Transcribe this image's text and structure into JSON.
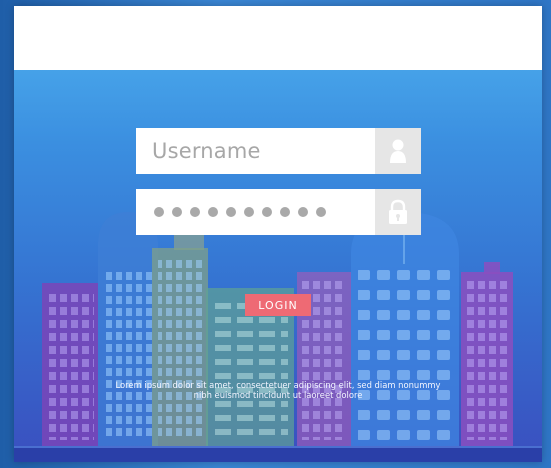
{
  "login_form": {
    "username_placeholder": "Username",
    "password_mask_count": 10,
    "login_label": "LOGIN",
    "tagline": "Lorem ipsum dolor sit amet, consectetuer adipiscing elit, sed diam nonummy nibh euismod tincidunt ut laoreet dolore"
  },
  "icons": {
    "username": "user-icon",
    "password": "lock-icon"
  },
  "colors": {
    "login_button": "#ee6a74",
    "input_background": "#ffffff",
    "icon_box": "#e6e6e6",
    "sky_top": "#4fb2f0",
    "sky_bottom": "#3a4fbf"
  }
}
